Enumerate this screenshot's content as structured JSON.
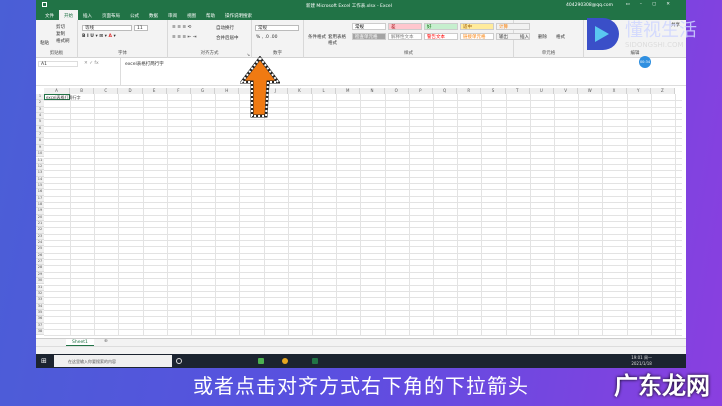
{
  "window": {
    "title": "新建 Microsoft Excel 工作表.xlsx - Excel",
    "account": "404290308@qq.com",
    "share": "共享"
  },
  "tabs": [
    "文件",
    "开始",
    "插入",
    "页面布局",
    "公式",
    "数据",
    "审阅",
    "视图",
    "帮助",
    "操作说明搜索"
  ],
  "ribbon": {
    "clipboard": {
      "paste": "粘贴",
      "cut": "剪切",
      "copy": "复制",
      "format_painter": "格式刷",
      "label": "剪贴板"
    },
    "font": {
      "name": "等线",
      "size": "11",
      "label": "字体"
    },
    "alignment": {
      "wrap": "自动换行",
      "merge": "合并后居中",
      "label": "对齐方式"
    },
    "number": {
      "format": "常规",
      "label": "数字"
    },
    "styles": {
      "cond": "条件格式",
      "table": "套用表格格式",
      "items": [
        {
          "t": "常规",
          "bg": "#ffffff",
          "c": "#000"
        },
        {
          "t": "差",
          "bg": "#ffc7ce",
          "c": "#9c0006"
        },
        {
          "t": "好",
          "bg": "#c6efce",
          "c": "#006100"
        },
        {
          "t": "适中",
          "bg": "#ffeb9c",
          "c": "#9c5700"
        },
        {
          "t": "计算",
          "bg": "#f2f2f2",
          "c": "#fa7d00"
        },
        {
          "t": "检查单元格",
          "bg": "#a5a5a5",
          "c": "#fff"
        },
        {
          "t": "解释性文本",
          "bg": "#fff",
          "c": "#7f7f7f"
        },
        {
          "t": "警告文本",
          "bg": "#fff",
          "c": "#ff0000"
        },
        {
          "t": "链接单元格",
          "bg": "#fff",
          "c": "#fa7d00"
        },
        {
          "t": "输出",
          "bg": "#f2f2f2",
          "c": "#3f3f3f"
        }
      ],
      "label": "样式"
    },
    "cells": {
      "insert": "插入",
      "delete": "删除",
      "format": "格式",
      "label": "单元格"
    },
    "editing": {
      "label": "编辑"
    }
  },
  "formula": {
    "namebox": "A1",
    "content": "excel表格打两行字"
  },
  "sheet": {
    "columns": [
      "A",
      "B",
      "C",
      "D",
      "E",
      "F",
      "G",
      "H",
      "I",
      "J",
      "K",
      "L",
      "M",
      "N",
      "O",
      "P",
      "Q",
      "R",
      "S",
      "T",
      "U",
      "V",
      "W",
      "X",
      "Y",
      "Z"
    ],
    "rows": 38,
    "a1": "excel表格打两行字",
    "tab": "Sheet1"
  },
  "taskbar": {
    "search": "在这里输入你要搜索的内容",
    "time": "19:01 周一",
    "date": "2021/1/18"
  },
  "overlay": {
    "subtitle": "或者点击对齐方式右下角的下拉箭头",
    "brand": "广东龙网",
    "logo_text": "懂视生活",
    "logo_domain": "SIDONGSHI.COM",
    "timer": "00:34"
  },
  "colors": {
    "excel_green": "#217346",
    "arrow": "#f07a12"
  }
}
